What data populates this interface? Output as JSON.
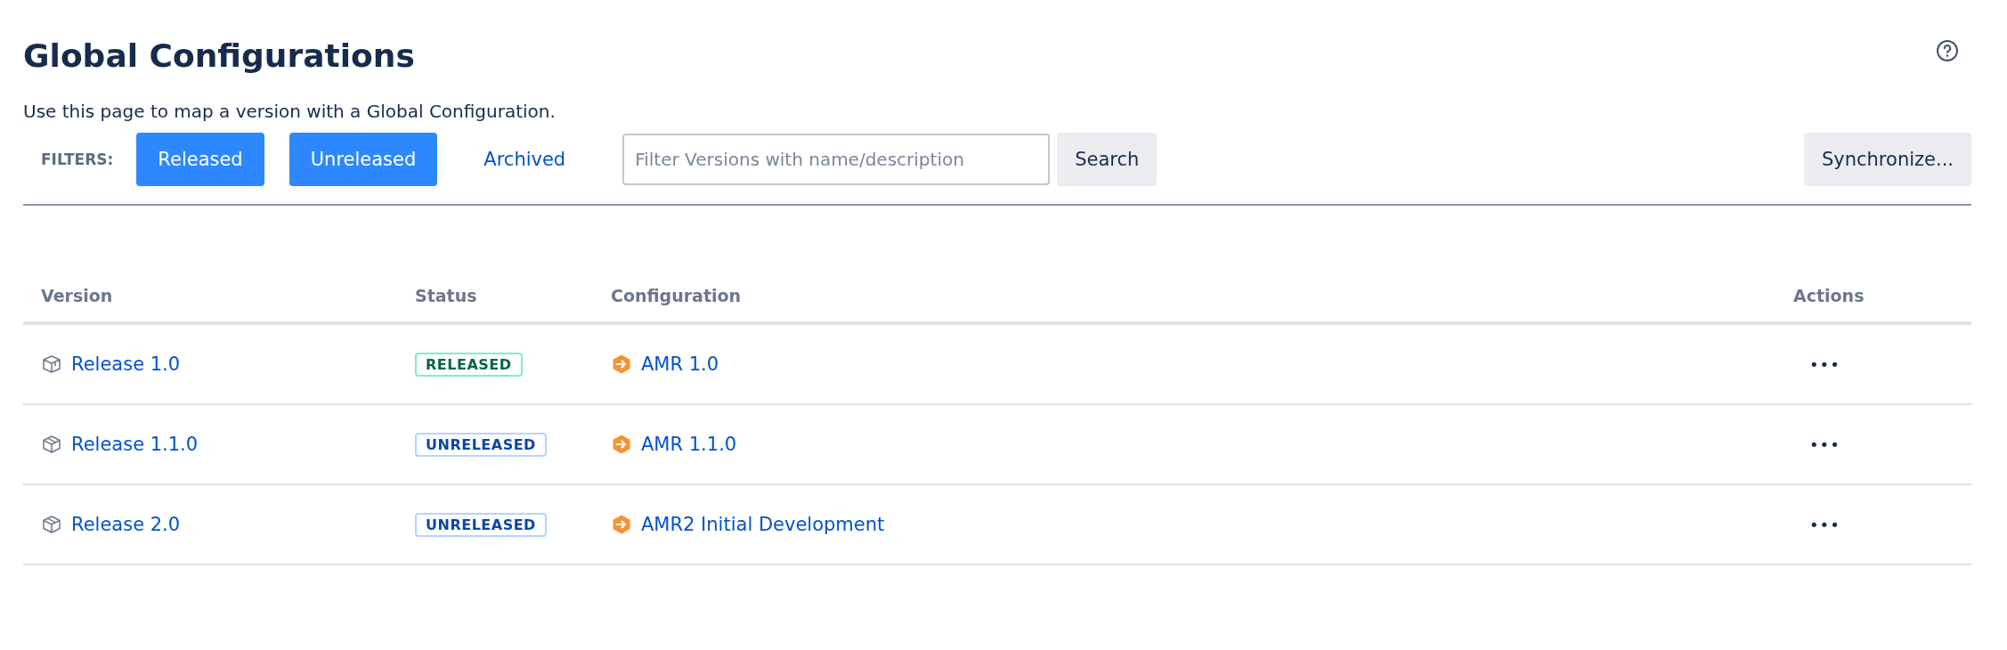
{
  "page": {
    "title": "Global Configurations",
    "description": "Use this page to map a version with a Global Configuration."
  },
  "filters": {
    "label": "FILTERS:",
    "items": [
      {
        "label": "Released",
        "selected": true
      },
      {
        "label": "Unreleased",
        "selected": true
      },
      {
        "label": "Archived",
        "selected": false
      }
    ],
    "search": {
      "placeholder": "Filter Versions with name/description"
    },
    "search_button": "Search",
    "sync_button": "Synchronize..."
  },
  "table": {
    "columns": [
      "Version",
      "Status",
      "Configuration",
      "Actions"
    ],
    "rows": [
      {
        "version": "Release 1.0",
        "status": {
          "label": "RELEASED",
          "kind": "released"
        },
        "configuration": "AMR 1.0",
        "actions": "•••"
      },
      {
        "version": "Release 1.1.0",
        "status": {
          "label": "UNRELEASED",
          "kind": "unreleased"
        },
        "configuration": "AMR 1.1.0",
        "actions": "•••"
      },
      {
        "version": "Release 2.0",
        "status": {
          "label": "UNRELEASED",
          "kind": "unreleased"
        },
        "configuration": "AMR2 Initial Development",
        "actions": "•••"
      }
    ]
  }
}
